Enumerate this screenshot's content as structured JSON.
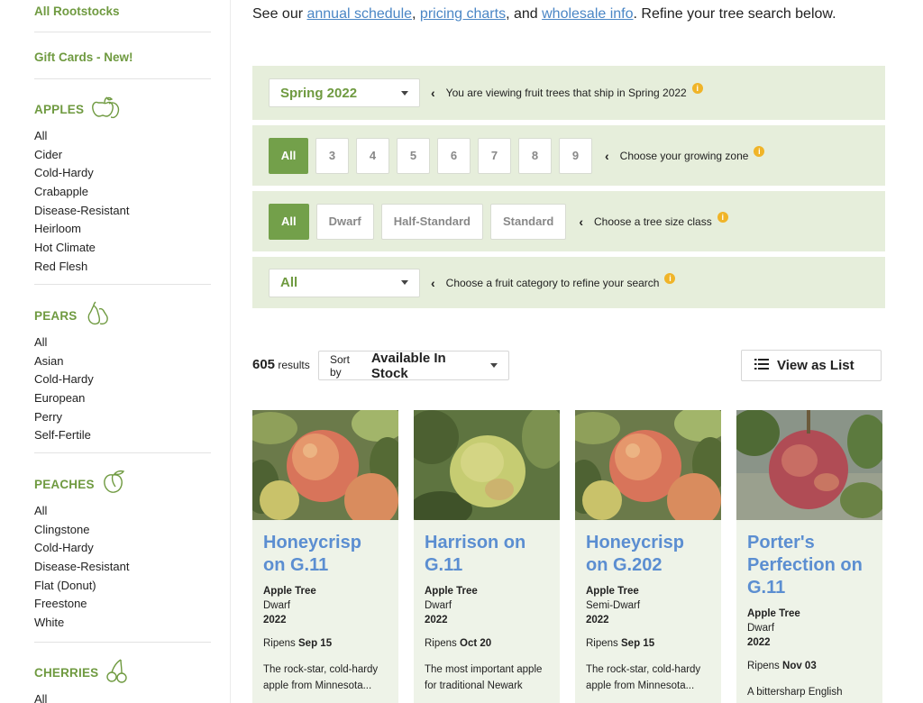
{
  "sidebar": {
    "all_rootstocks": "All Rootstocks",
    "gift_cards": "Gift Cards - New!",
    "categories": [
      {
        "title": "APPLES",
        "icon": "apple-icon",
        "items": [
          "All",
          "Cider",
          "Cold-Hardy",
          "Crabapple",
          "Disease-Resistant",
          "Heirloom",
          "Hot Climate",
          "Red Flesh"
        ]
      },
      {
        "title": "PEARS",
        "icon": "pear-icon",
        "items": [
          "All",
          "Asian",
          "Cold-Hardy",
          "European",
          "Perry",
          "Self-Fertile"
        ]
      },
      {
        "title": "PEACHES",
        "icon": "peach-icon",
        "items": [
          "All",
          "Clingstone",
          "Cold-Hardy",
          "Disease-Resistant",
          "Flat (Donut)",
          "Freestone",
          "White"
        ]
      },
      {
        "title": "CHERRIES",
        "icon": "cherry-icon",
        "items": [
          "All"
        ]
      }
    ]
  },
  "intro": {
    "prefix": "See our ",
    "link1": "annual schedule",
    "sep1": ", ",
    "link2": "pricing charts",
    "sep2": ", and ",
    "link3": "wholesale info",
    "suffix": ". Refine your tree search below."
  },
  "filters": {
    "season": {
      "value": "Spring 2022",
      "hint": "You are viewing fruit trees that ship in Spring 2022"
    },
    "zone": {
      "options": [
        "All",
        "3",
        "4",
        "5",
        "6",
        "7",
        "8",
        "9"
      ],
      "selected": "All",
      "hint": "Choose your growing zone"
    },
    "size": {
      "options": [
        "All",
        "Dwarf",
        "Half-Standard",
        "Standard"
      ],
      "selected": "All",
      "hint": "Choose a tree size class"
    },
    "category": {
      "value": "All",
      "hint": "Choose a fruit category to refine your search"
    }
  },
  "results": {
    "count": "605",
    "count_label": "results",
    "sort_label": "Sort by",
    "sort_value": "Available In Stock",
    "view_label": "View as List"
  },
  "products": [
    {
      "name": "Honeycrisp on G.11",
      "type": "Apple Tree",
      "size": "Dwarf",
      "year": "2022",
      "ripens_label": "Ripens",
      "ripens": "Sep 15",
      "desc": "The rock-star, cold-hardy apple from Minnesota..."
    },
    {
      "name": "Harrison on G.11",
      "type": "Apple Tree",
      "size": "Dwarf",
      "year": "2022",
      "ripens_label": "Ripens",
      "ripens": "Oct 20",
      "desc": "The most important apple for traditional Newark"
    },
    {
      "name": "Honeycrisp on G.202",
      "type": "Apple Tree",
      "size": "Semi-Dwarf",
      "year": "2022",
      "ripens_label": "Ripens",
      "ripens": "Sep 15",
      "desc": "The rock-star, cold-hardy apple from Minnesota..."
    },
    {
      "name": "Porter's Perfection on G.11",
      "type": "Apple Tree",
      "size": "Dwarf",
      "year": "2022",
      "ripens_label": "Ripens",
      "ripens": "Nov 03",
      "desc": "A bittersharp English"
    }
  ],
  "colors": {
    "brand_green": "#6f9a40",
    "active_green": "#73a04a",
    "filter_bg": "#e6eedb",
    "link_blue": "#4a86c5",
    "card_title_blue": "#5b8ed1",
    "info_yellow": "#f0b428"
  }
}
